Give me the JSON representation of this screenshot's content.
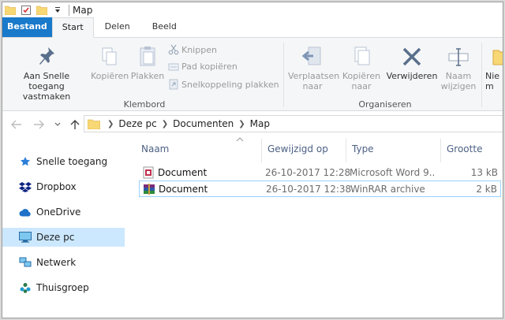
{
  "window": {
    "title": "Map"
  },
  "tabs": [
    {
      "label": "Bestand"
    },
    {
      "label": "Start"
    },
    {
      "label": "Delen"
    },
    {
      "label": "Beeld"
    }
  ],
  "ribbon": {
    "pin": {
      "line1": "Aan Snelle toegang",
      "line2": "vastmaken"
    },
    "copy": "Kopiëren",
    "paste": "Plakken",
    "cut": "Knippen",
    "copy_path": "Pad kopiëren",
    "paste_shortcut": "Snelkoppeling plakken",
    "clipboard_group": "Klembord",
    "move_to": {
      "line1": "Verplaatsen",
      "line2": "naar"
    },
    "copy_to": {
      "line1": "Kopiëren",
      "line2": "naar"
    },
    "delete": "Verwijderen",
    "rename": {
      "line1": "Naam",
      "line2": "wijzigen"
    },
    "organize_group": "Organiseren",
    "new_folder": {
      "line1": "Nie",
      "line2": "m"
    }
  },
  "breadcrumb": [
    "Deze pc",
    "Documenten",
    "Map"
  ],
  "sidebar": {
    "items": [
      {
        "label": "Snelle toegang",
        "icon": "star-icon"
      },
      {
        "label": "Dropbox",
        "icon": "dropbox-icon"
      },
      {
        "label": "OneDrive",
        "icon": "cloud-icon"
      },
      {
        "label": "Deze pc",
        "icon": "computer-icon"
      },
      {
        "label": "Netwerk",
        "icon": "network-icon"
      },
      {
        "label": "Thuisgroep",
        "icon": "homegroup-icon"
      }
    ]
  },
  "columns": {
    "name": "Naam",
    "modified": "Gewijzigd op",
    "type": "Type",
    "size": "Grootte"
  },
  "files": [
    {
      "name": "Document",
      "modified": "26-10-2017 12:28",
      "type": "Microsoft Word 9...",
      "size": "13 kB",
      "icon": "word-document-icon"
    },
    {
      "name": "Document",
      "modified": "26-10-2017 12:38",
      "type": "WinRAR archive",
      "size": "2 kB",
      "icon": "winrar-archive-icon"
    }
  ],
  "colors": {
    "accent": "#1979ca",
    "selection": "#cce8ff",
    "header_text": "#4d6185"
  }
}
